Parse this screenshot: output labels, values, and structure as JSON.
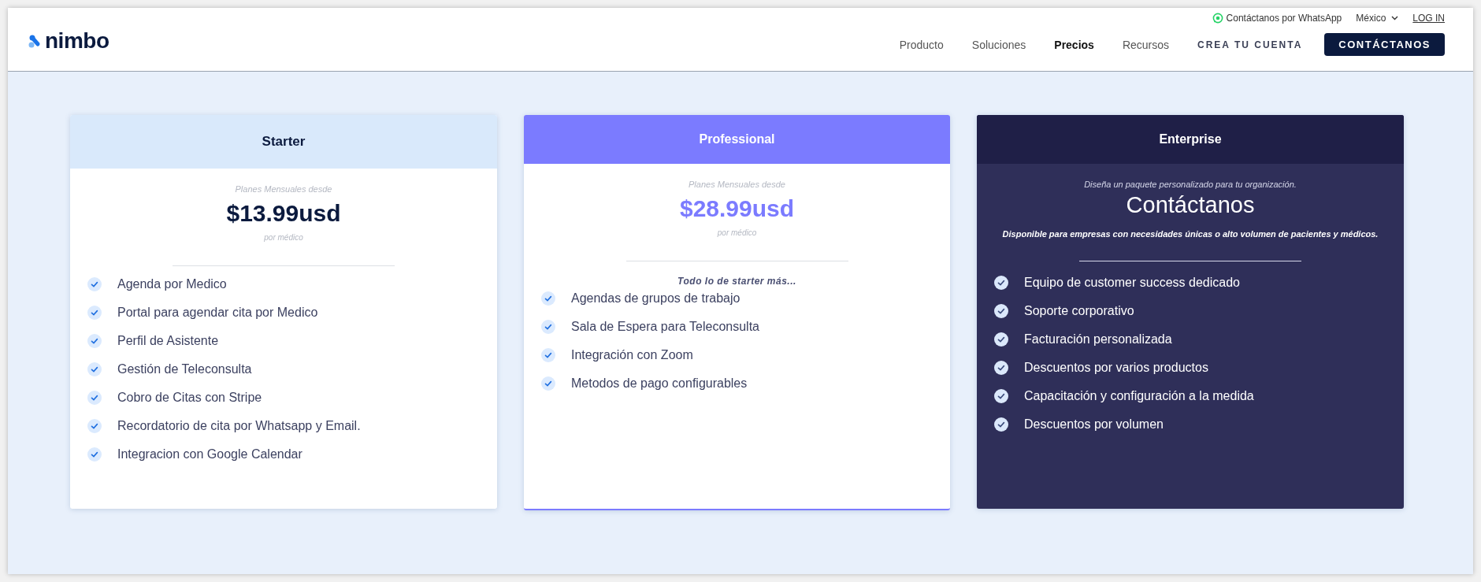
{
  "header": {
    "logo": "nimbo",
    "whatsapp": "Contáctanos por WhatsApp",
    "country": "México",
    "login": "LOG IN",
    "nav": [
      {
        "label": "Producto",
        "selected": false
      },
      {
        "label": "Soluciones",
        "selected": false
      },
      {
        "label": "Precios",
        "selected": true
      },
      {
        "label": "Recursos",
        "selected": false
      }
    ],
    "signup": "CREA TU CUENTA",
    "contact": "CONTÁCTANOS"
  },
  "plans": [
    {
      "kind": "basic",
      "name": "Starter",
      "caption": "Planes Mensuales desde",
      "price": "$13.99usd",
      "unit": "por médico",
      "features": [
        "Agenda por Medico",
        "Portal para agendar cita por Medico",
        "Perfil de Asistente",
        "Gestión de Teleconsulta",
        "Cobro de Citas con Stripe",
        "Recordatorio de cita por Whatsapp y Email.",
        "Integracion con Google Calendar"
      ]
    },
    {
      "kind": "featured",
      "name": "Professional",
      "caption": "Planes Mensuales desde",
      "price": "$28.99usd",
      "unit": "por médico",
      "intro": "Todo lo de starter más...",
      "features": [
        "Agendas de grupos de trabajo",
        "Sala de Espera para Teleconsulta",
        "Integración con Zoom",
        "Metodos de pago configurables"
      ]
    },
    {
      "kind": "custom",
      "name": "Enterprise",
      "caption": "Diseña un paquete personalizado para tu organización.",
      "price": "Contáctanos",
      "unit": "Disponible para empresas con necesidades únicas o alto volumen de pacientes y médicos.",
      "features": [
        "Equipo de customer success dedicado",
        "Soporte corporativo",
        "Facturación personalizada",
        "Descuentos por varios productos",
        "Capacitación y configuración a la medida",
        "Descuentos por volumen"
      ]
    }
  ]
}
